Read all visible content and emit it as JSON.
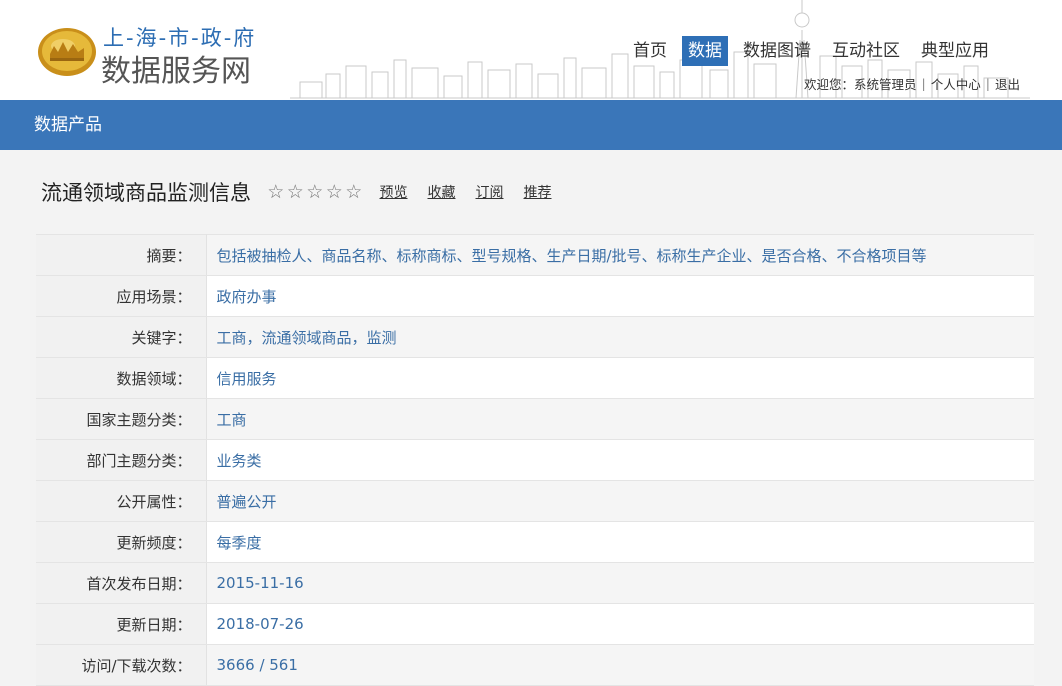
{
  "header": {
    "site_name_line1": "上-海-市-政-府",
    "site_name_line2": "数据服务网",
    "nav": [
      {
        "label": "首页",
        "active": false
      },
      {
        "label": "数据",
        "active": true
      },
      {
        "label": "数据图谱",
        "active": false
      },
      {
        "label": "互动社区",
        "active": false
      },
      {
        "label": "典型应用",
        "active": false
      }
    ],
    "user": {
      "welcome": "欢迎您：系统管理员",
      "sep": "|",
      "personal_center": "个人中心",
      "logout": "退出"
    }
  },
  "section": {
    "title": "数据产品"
  },
  "product": {
    "title": "流通领域商品监测信息",
    "rating": 0,
    "stars": [
      "☆",
      "☆",
      "☆",
      "☆",
      "☆"
    ],
    "actions": {
      "preview": "预览",
      "favorite": "收藏",
      "subscribe": "订阅",
      "recommend": "推荐"
    }
  },
  "meta": [
    {
      "label": "摘要：",
      "value": "包括被抽检人、商品名称、标称商标、型号规格、生产日期/批号、标称生产企业、是否合格、不合格项目等"
    },
    {
      "label": "应用场景：",
      "value": "政府办事"
    },
    {
      "label": "关键字：",
      "value": "工商，流通领域商品，监测"
    },
    {
      "label": "数据领域：",
      "value": "信用服务"
    },
    {
      "label": "国家主题分类：",
      "value": "工商"
    },
    {
      "label": "部门主题分类：",
      "value": "业务类"
    },
    {
      "label": "公开属性：",
      "value": "普遍公开"
    },
    {
      "label": "更新频度：",
      "value": "每季度"
    },
    {
      "label": "首次发布日期：",
      "value": "2015-11-16"
    },
    {
      "label": "更新日期：",
      "value": "2018-07-26"
    },
    {
      "label": "访问/下载次数：",
      "value": "3666 / 561"
    }
  ],
  "colors": {
    "brand_blue": "#3a76b9",
    "nav_active": "#2e6fb6",
    "link_blue": "#3a6ea5",
    "logo_gold": "#d8a72a"
  }
}
